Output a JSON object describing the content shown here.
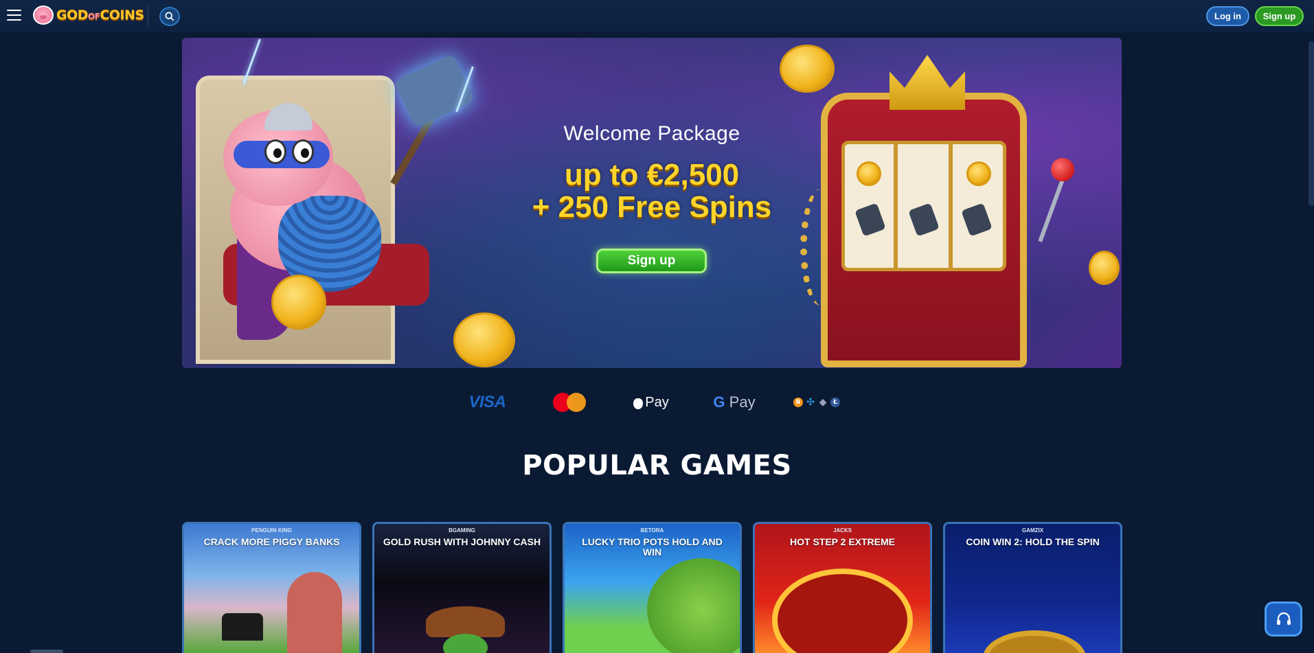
{
  "header": {
    "menu_icon": "hamburger-menu-icon",
    "logo": {
      "text_main": "GOD",
      "text_of": "OF",
      "text_end": "COINS",
      "icon": "pig-logo-icon"
    },
    "search_icon": "search-icon",
    "login_label": "Log in",
    "signup_label": "Sign up"
  },
  "hero": {
    "title": "Welcome Package",
    "offer_line1": "up to €2,500",
    "offer_line2": "+ 250 Free Spins",
    "cta_label": "Sign up"
  },
  "payments": {
    "visa": "VISA",
    "mastercard": "mastercard-icon",
    "applepay": "Pay",
    "googlepay_g": "G",
    "googlepay": "Pay",
    "crypto": [
      "B",
      "✣",
      "◆",
      "Ł"
    ]
  },
  "popular": {
    "title": "POPULAR GAMES",
    "games": [
      {
        "provider": "PENGUIN KING",
        "title": "CRACK MORE PIGGY BANKS"
      },
      {
        "provider": "BGAMING",
        "title": "GOLD RUSH WITH JOHNNY CASH"
      },
      {
        "provider": "BETORA",
        "title": "LUCKY TRIO POTS HOLD AND WIN"
      },
      {
        "provider": "JACKS",
        "title": "HOT STEP 2 EXTREME"
      },
      {
        "provider": "GAMZIX",
        "title": "COIN WIN 2: HOLD THE SPIN"
      }
    ]
  },
  "support_icon": "headset-icon",
  "colors": {
    "background": "#0b1a33",
    "accent_green": "#2b9a23",
    "accent_blue": "#1d5aa8",
    "gold": "#ffd52b"
  }
}
